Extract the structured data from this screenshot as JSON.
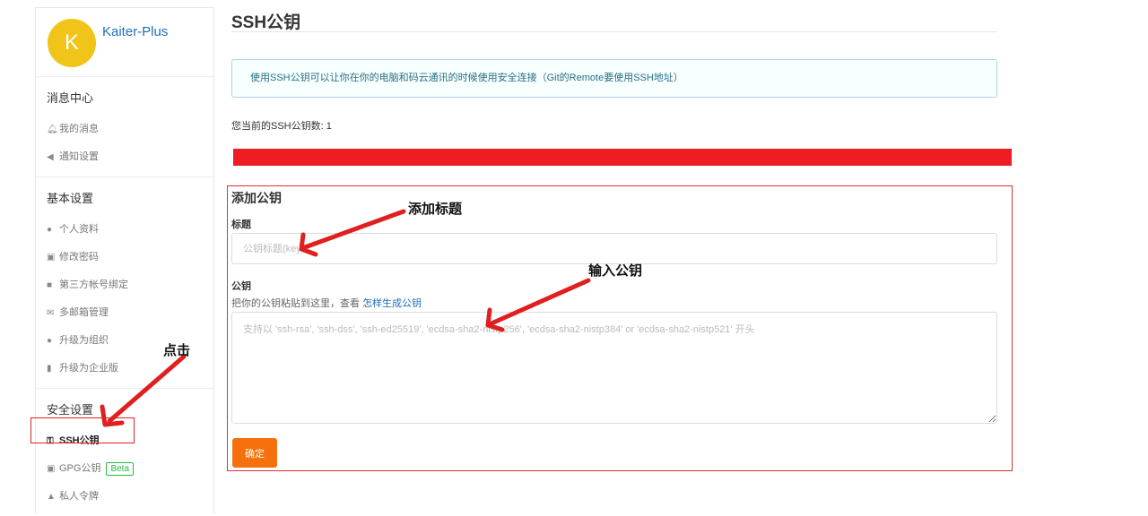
{
  "sidebar": {
    "username": "Kaiter-Plus",
    "avatar_letter": "K",
    "avatar_color": "#f0c419",
    "sections": [
      {
        "title": "消息中心",
        "items": [
          {
            "icon": "bell-icon",
            "label": "我的消息"
          },
          {
            "icon": "speaker-icon",
            "label": "通知设置"
          }
        ]
      },
      {
        "title": "基本设置",
        "items": [
          {
            "icon": "user-icon",
            "label": "个人资料"
          },
          {
            "icon": "unlock-icon",
            "label": "修改密码"
          },
          {
            "icon": "id-card-icon",
            "label": "第三方帐号绑定"
          },
          {
            "icon": "mail-icon",
            "label": "多邮箱管理"
          },
          {
            "icon": "users-icon",
            "label": "升级为组织"
          },
          {
            "icon": "building-icon",
            "label": "升级为企业版"
          }
        ]
      },
      {
        "title": "安全设置",
        "items": [
          {
            "icon": "key-icon",
            "label": "SSH公钥"
          },
          {
            "icon": "lock-icon",
            "label": "GPG公钥",
            "badge": "Beta"
          },
          {
            "icon": "spy-icon",
            "label": "私人令牌"
          }
        ]
      }
    ]
  },
  "main": {
    "title": "SSH公钥",
    "info": "使用SSH公钥可以让你在你的电脑和码云通讯的时候使用安全连接（Git的Remote要使用SSH地址）",
    "key_count": "您当前的SSH公钥数: 1",
    "form": {
      "heading": "添加公钥",
      "title_label": "标题",
      "title_placeholder": "公钥标题(key",
      "key_label": "公钥",
      "key_help": "把你的公钥粘贴到这里，查看 ",
      "key_help_link": "怎样生成公钥",
      "key_placeholder": "支持以 'ssh-rsa', 'ssh-dss', 'ssh-ed25519', 'ecdsa-sha2-nistp256', 'ecdsa-sha2-nistp384' or 'ecdsa-sha2-nistp521' 开头",
      "submit": "确定"
    }
  },
  "annotations": {
    "click": "点击",
    "add_title": "添加标题",
    "input_key": "输入公钥"
  },
  "colors": {
    "accent": "#f6710d",
    "link": "#1e6fb8",
    "annotation_red": "#e02020"
  }
}
